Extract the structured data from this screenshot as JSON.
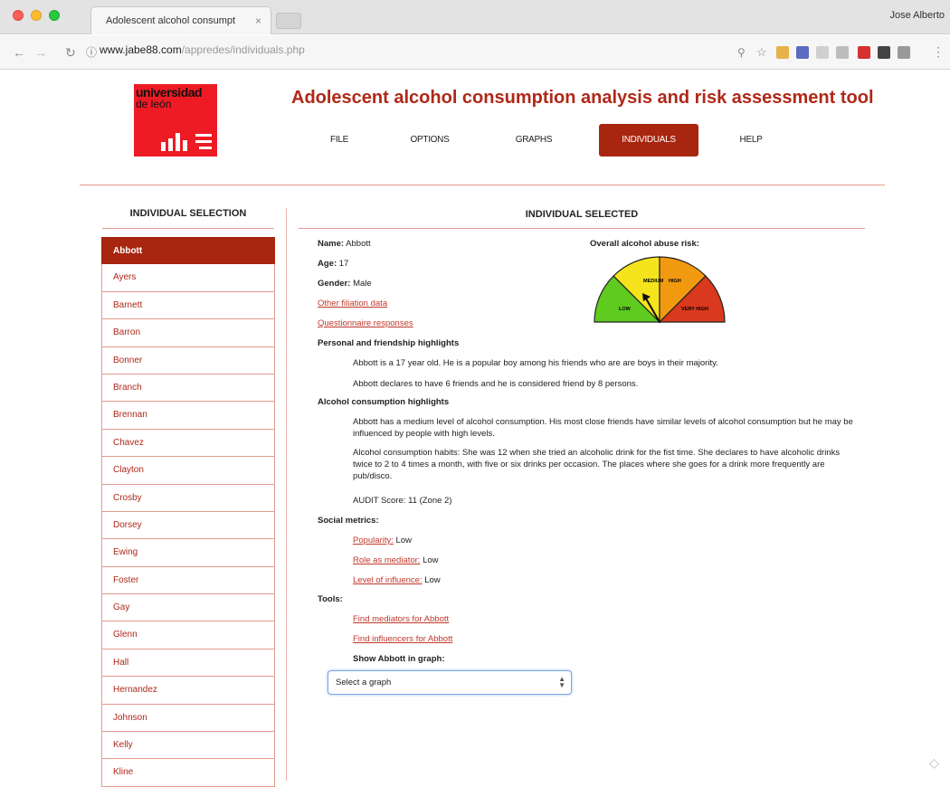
{
  "browser": {
    "tab_title": "Adolescent alcohol consumpt",
    "tab_close": "×",
    "user": "Jose Alberto",
    "url_host": "www.jabe88.com",
    "url_path": "/appredes/individuals.php",
    "icons": [
      "back-icon",
      "forward-icon",
      "reload-icon",
      "info-icon",
      "search-icon",
      "star-icon"
    ]
  },
  "header": {
    "logo_text": "universidad",
    "logo_sub": "de león",
    "title": "Adolescent alcohol consumption analysis and risk assessment tool",
    "nav": [
      {
        "label": "FILE"
      },
      {
        "label": "OPTIONS"
      },
      {
        "label": "GRAPHS"
      },
      {
        "label": "INDIVIDUALS"
      },
      {
        "label": "HELP"
      }
    ],
    "active_nav": "INDIVIDUALS"
  },
  "sidebar": {
    "heading": "INDIVIDUAL SELECTION",
    "items": [
      "Abbott",
      "Ayers",
      "Barnett",
      "Barron",
      "Bonner",
      "Branch",
      "Brennan",
      "Chavez",
      "Clayton",
      "Crosby",
      "Dorsey",
      "Ewing",
      "Foster",
      "Gay",
      "Glenn",
      "Hall",
      "Hernandez",
      "Johnson",
      "Kelly",
      "Kline"
    ],
    "selected": "Abbott"
  },
  "detail": {
    "heading": "INDIVIDUAL SELECTED",
    "name_label": "Name:",
    "name": "Abbott",
    "age_label": "Age:",
    "age": "17",
    "gender_label": "Gender:",
    "gender": "Male",
    "filiation_link": "Other filiation data",
    "questionnaire_link": "Questionnaire responses",
    "risk_label": "Overall alcohol abuse risk:",
    "gauge": {
      "segments": [
        "LOW",
        "MEDIUM",
        "HIGH",
        "VERY HIGH"
      ],
      "colors": [
        "#5fcb1e",
        "#f5e41c",
        "#f29a0f",
        "#d9391c"
      ],
      "level": "MEDIUM"
    },
    "personal_heading": "Personal and friendship highlights",
    "personal_p1": "Abbott is a 17 year old. He is a popular boy among his friends who are are boys in their majority.",
    "personal_p2": "Abbott declares to have 6 friends and he is considered friend by 8 persons.",
    "alcohol_heading": "Alcohol consumption highlights",
    "alcohol_p1": "Abbott has a medium level of alcohol consumption. His most close friends have similar levels of alcohol consumption but he may be influenced by people with high levels.",
    "alcohol_p2": "Alcohol consumption habits: She was 12 when she tried an alcoholic drink for the fist time. She declares to have alcoholic drinks twice to 2 to 4 times a month, with five or six drinks per occasion. The places where she goes for a drink more frequently are pub/disco.",
    "audit": "AUDIT Score: 11 (Zone 2)",
    "social_heading": "Social metrics:",
    "metrics": [
      {
        "label": "Popularity:",
        "value": "Low"
      },
      {
        "label": "Role as mediator:",
        "value": "Low"
      },
      {
        "label": "Level of influence:",
        "value": "Low"
      }
    ],
    "tools_heading": "Tools:",
    "tool_mediators": "Find mediators for Abbott",
    "tool_influencers": "Find influencers for Abbott",
    "graph_label": "Show Abbott in graph:",
    "graph_select": "Select a graph"
  }
}
